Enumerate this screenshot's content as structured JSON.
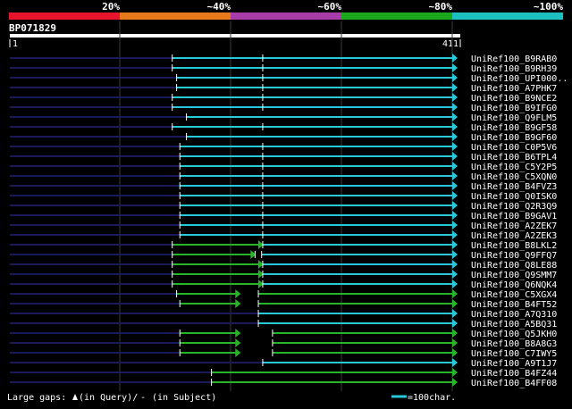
{
  "identity_scale": {
    "labels": [
      "20%",
      "~40%",
      "~60%",
      "~80%",
      "~100%"
    ],
    "colors": [
      "#e8142c",
      "#e87a1c",
      "#a83ca8",
      "#1ca81c",
      "#1cc0c0"
    ]
  },
  "query": {
    "id": "BP071829",
    "start": "1",
    "end": "411",
    "length": 411
  },
  "colors": {
    "background": "#000000",
    "grid": "#3a3a3a",
    "unaligned": "#1a1a5a",
    "high_identity": "#28c8d8",
    "medium_identity": "#28b428",
    "tick": "#ffffff",
    "query_bar": "#ffffff"
  },
  "hits": [
    {
      "name": "UniRef100_B9RAB0",
      "segments": [
        {
          "from": 150,
          "to": 411,
          "color": "high"
        }
      ],
      "breaks": [
        233
      ]
    },
    {
      "name": "UniRef100_B9RH39",
      "segments": [
        {
          "from": 150,
          "to": 411,
          "color": "high"
        }
      ],
      "breaks": [
        233
      ]
    },
    {
      "name": "UniRef100_UPI000..",
      "segments": [
        {
          "from": 154,
          "to": 411,
          "color": "high"
        }
      ],
      "breaks": [
        233
      ]
    },
    {
      "name": "UniRef100_A7PHK7",
      "segments": [
        {
          "from": 154,
          "to": 411,
          "color": "high"
        }
      ],
      "breaks": [
        233
      ]
    },
    {
      "name": "UniRef100_B9NCE2",
      "segments": [
        {
          "from": 150,
          "to": 411,
          "color": "high"
        }
      ],
      "breaks": [
        233
      ]
    },
    {
      "name": "UniRef100_B9IFG0",
      "segments": [
        {
          "from": 150,
          "to": 411,
          "color": "high"
        }
      ],
      "breaks": [
        233
      ]
    },
    {
      "name": "UniRef100_Q9FLM5",
      "segments": [
        {
          "from": 163,
          "to": 411,
          "color": "high"
        }
      ],
      "breaks": []
    },
    {
      "name": "UniRef100_B9GF58",
      "segments": [
        {
          "from": 150,
          "to": 411,
          "color": "high"
        }
      ],
      "breaks": [
        233
      ]
    },
    {
      "name": "UniRef100_B9GF60",
      "segments": [
        {
          "from": 163,
          "to": 411,
          "color": "high"
        }
      ],
      "breaks": []
    },
    {
      "name": "UniRef100_C0P5V6",
      "segments": [
        {
          "from": 157,
          "to": 411,
          "color": "high"
        }
      ],
      "breaks": [
        233
      ]
    },
    {
      "name": "UniRef100_B6TPL4",
      "segments": [
        {
          "from": 157,
          "to": 411,
          "color": "high"
        }
      ],
      "breaks": [
        233
      ]
    },
    {
      "name": "UniRef100_C5Y2P5",
      "segments": [
        {
          "from": 157,
          "to": 411,
          "color": "high"
        }
      ],
      "breaks": [
        233
      ]
    },
    {
      "name": "UniRef100_C5XQN0",
      "segments": [
        {
          "from": 157,
          "to": 411,
          "color": "high"
        }
      ],
      "breaks": [
        233
      ]
    },
    {
      "name": "UniRef100_B4FVZ3",
      "segments": [
        {
          "from": 157,
          "to": 411,
          "color": "high"
        }
      ],
      "breaks": [
        233
      ]
    },
    {
      "name": "UniRef100_Q0ISK0",
      "segments": [
        {
          "from": 157,
          "to": 411,
          "color": "high"
        }
      ],
      "breaks": [
        233
      ]
    },
    {
      "name": "UniRef100_Q2R3Q9",
      "segments": [
        {
          "from": 157,
          "to": 411,
          "color": "high"
        }
      ],
      "breaks": [
        233
      ]
    },
    {
      "name": "UniRef100_B9GAV1",
      "segments": [
        {
          "from": 157,
          "to": 411,
          "color": "high"
        }
      ],
      "breaks": [
        233
      ]
    },
    {
      "name": "UniRef100_A2ZEK7",
      "segments": [
        {
          "from": 157,
          "to": 411,
          "color": "high"
        }
      ],
      "breaks": [
        233
      ]
    },
    {
      "name": "UniRef100_A2ZEK3",
      "segments": [
        {
          "from": 157,
          "to": 411,
          "color": "high"
        }
      ],
      "breaks": [
        233
      ]
    },
    {
      "name": "UniRef100_B8LKL2",
      "segments": [
        {
          "from": 150,
          "to": 233,
          "color": "med"
        },
        {
          "from": 233,
          "to": 411,
          "color": "high"
        }
      ],
      "breaks": []
    },
    {
      "name": "UniRef100_Q9FFQ7",
      "segments": [
        {
          "from": 150,
          "to": 226,
          "color": "med"
        },
        {
          "from": 232,
          "to": 411,
          "color": "high"
        }
      ],
      "breaks": [
        226
      ]
    },
    {
      "name": "UniRef100_Q8LE88",
      "segments": [
        {
          "from": 150,
          "to": 233,
          "color": "med"
        },
        {
          "from": 233,
          "to": 411,
          "color": "high"
        }
      ],
      "breaks": []
    },
    {
      "name": "UniRef100_Q9SMM7",
      "segments": [
        {
          "from": 150,
          "to": 233,
          "color": "med"
        },
        {
          "from": 233,
          "to": 411,
          "color": "high"
        }
      ],
      "breaks": []
    },
    {
      "name": "UniRef100_Q6NQK4",
      "segments": [
        {
          "from": 150,
          "to": 233,
          "color": "med"
        },
        {
          "from": 233,
          "to": 411,
          "color": "high"
        }
      ],
      "breaks": []
    },
    {
      "name": "UniRef100_C5XGX4",
      "segments": [
        {
          "from": 154,
          "to": 212,
          "color": "med"
        },
        {
          "from": 229,
          "to": 411,
          "color": "med"
        }
      ],
      "breaks": []
    },
    {
      "name": "UniRef100_B4FT52",
      "segments": [
        {
          "from": 157,
          "to": 212,
          "color": "med"
        },
        {
          "from": 229,
          "to": 411,
          "color": "med"
        }
      ],
      "breaks": []
    },
    {
      "name": "UniRef100_A7Q310",
      "segments": [
        {
          "from": 229,
          "to": 411,
          "color": "high"
        }
      ],
      "breaks": []
    },
    {
      "name": "UniRef100_A5BQ31",
      "segments": [
        {
          "from": 229,
          "to": 411,
          "color": "high"
        }
      ],
      "breaks": []
    },
    {
      "name": "UniRef100_Q5JKH0",
      "segments": [
        {
          "from": 157,
          "to": 212,
          "color": "med"
        },
        {
          "from": 242,
          "to": 411,
          "color": "med"
        }
      ],
      "breaks": []
    },
    {
      "name": "UniRef100_B8A8G3",
      "segments": [
        {
          "from": 157,
          "to": 212,
          "color": "med"
        },
        {
          "from": 242,
          "to": 411,
          "color": "med"
        }
      ],
      "breaks": []
    },
    {
      "name": "UniRef100_C7IWY5",
      "segments": [
        {
          "from": 157,
          "to": 212,
          "color": "med"
        },
        {
          "from": 242,
          "to": 411,
          "color": "med"
        }
      ],
      "breaks": []
    },
    {
      "name": "UniRef100_A9T1J7",
      "segments": [
        {
          "from": 233,
          "to": 411,
          "color": "high"
        }
      ],
      "breaks": []
    },
    {
      "name": "UniRef100_B4FZ44",
      "segments": [
        {
          "from": 186,
          "to": 411,
          "color": "med"
        }
      ],
      "breaks": []
    },
    {
      "name": "UniRef100_B4FF08",
      "segments": [
        {
          "from": 186,
          "to": 411,
          "color": "med"
        }
      ],
      "breaks": []
    }
  ],
  "footer": {
    "gaps_label": "Large gaps:",
    "query_marker": "(in Query)/",
    "subject_marker": "-",
    "subject_label": "(in Subject)",
    "scale_label": "=100char."
  }
}
